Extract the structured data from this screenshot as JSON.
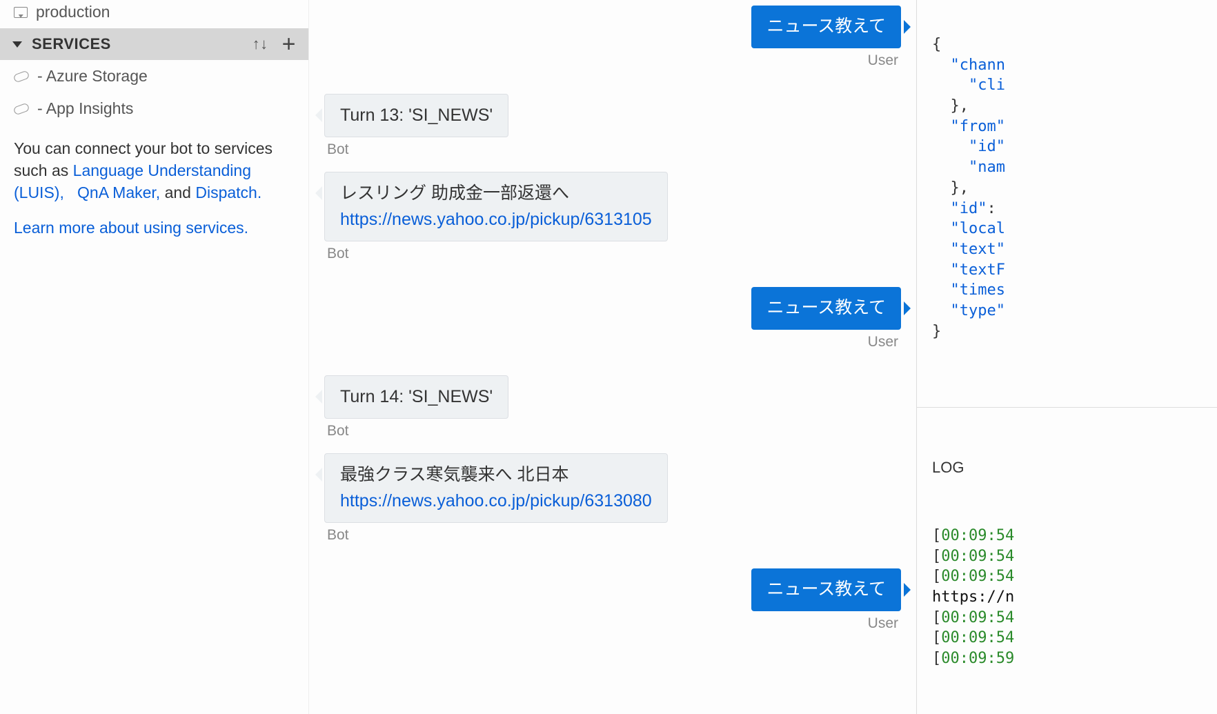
{
  "sidebar": {
    "endpoint": "production",
    "section_title": "SERVICES",
    "services": [
      {
        "label": "- Azure Storage"
      },
      {
        "label": "- App Insights"
      }
    ],
    "info_prefix": "You can connect your bot to services such as ",
    "link_luis": "Language Understanding (LUIS),",
    "link_qna": "QnA Maker,",
    "info_mid": " and ",
    "link_dispatch": "Dispatch.",
    "learn_more": "Learn more about using services."
  },
  "chat": {
    "user_label": "User",
    "bot_label": "Bot",
    "user_msg": "ニュース教えて",
    "turn13": "Turn 13: 'SI_NEWS'",
    "news1_title": "レスリング 助成金一部返還へ",
    "news1_url": "https://news.yahoo.co.jp/pickup/6313105",
    "turn14": "Turn 14: 'SI_NEWS'",
    "news2_title": "最強クラス寒気襲来へ 北日本",
    "news2_url": "https://news.yahoo.co.jp/pickup/6313080"
  },
  "inspector": {
    "json_lines": [
      "{",
      "  \"chann",
      "    \"cli",
      "  },",
      "  \"from\"",
      "    \"id\"",
      "    \"nam",
      "  },",
      "  \"id\":",
      "  \"local",
      "  \"text\"",
      "  \"textF",
      "  \"times",
      "  \"type\"",
      "}"
    ],
    "log_title": "LOG",
    "log_lines": [
      "[00:09:54",
      "[00:09:54",
      "[00:09:54",
      "https://n",
      "[00:09:54",
      "[00:09:54",
      "[00:09:59"
    ]
  }
}
